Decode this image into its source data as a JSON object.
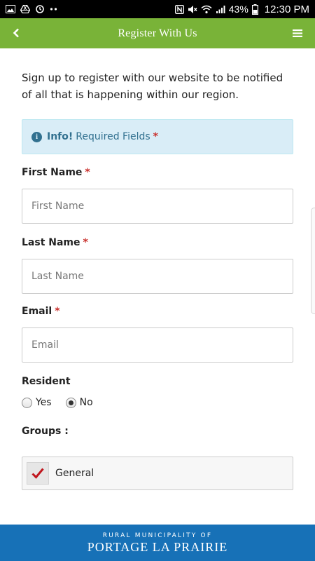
{
  "status_bar": {
    "battery": "43%",
    "time": "12:30 PM",
    "left_icons": [
      "gallery-icon",
      "drive-icon",
      "sync-icon",
      "more-dots-icon"
    ],
    "right_icons": [
      "nfc-icon",
      "mute-icon",
      "wifi-icon",
      "signal-icon",
      "battery-icon"
    ]
  },
  "header": {
    "title": "Register With Us",
    "back_icon": "back-chevron-icon",
    "menu_icon": "hamburger-menu-icon",
    "background": "#79b338"
  },
  "intro": {
    "text": "Sign up to register with our website to be notified of all that is happening within our region."
  },
  "alert": {
    "strong": "Info!",
    "text": "Required Fields",
    "star": "*",
    "icon": "info-circle-icon",
    "background": "#d9edf7",
    "text_color": "#31708f"
  },
  "form": {
    "first_name": {
      "label": "First Name",
      "required": "*",
      "placeholder": "First Name",
      "value": ""
    },
    "last_name": {
      "label": "Last Name",
      "required": "*",
      "placeholder": "Last Name",
      "value": ""
    },
    "email": {
      "label": "Email",
      "required": "*",
      "placeholder": "Email",
      "value": ""
    },
    "resident": {
      "label": "Resident",
      "options": [
        {
          "label": "Yes",
          "checked": false
        },
        {
          "label": "No",
          "checked": true
        }
      ]
    },
    "groups": {
      "label": "Groups :",
      "items": [
        {
          "label": "General",
          "checked": true,
          "check_color": "#c0161d"
        }
      ]
    }
  },
  "footer": {
    "line1": "RURAL MUNICIPALITY OF",
    "line2": "PORTAGE LA PRAIRIE",
    "background": "#1771b7"
  }
}
